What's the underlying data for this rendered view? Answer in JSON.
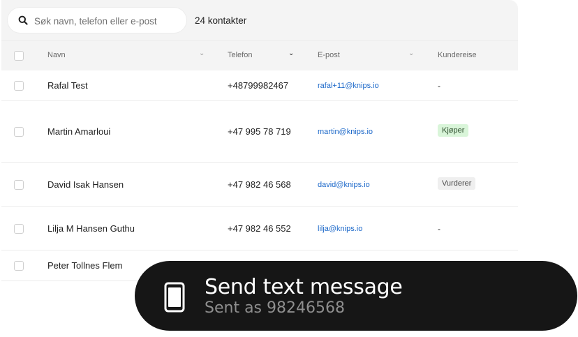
{
  "search": {
    "placeholder": "Søk navn, telefon eller e-post",
    "value": ""
  },
  "contact_count": "24 kontakter",
  "columns": {
    "name": "Navn",
    "phone": "Telefon",
    "email": "E-post",
    "journey": "Kundereise"
  },
  "rows": [
    {
      "name": "Rafal Test",
      "phone": "+48799982467",
      "email": "rafal+11@knips.io",
      "journey": "-"
    },
    {
      "name": "Martin Amarloui",
      "phone": "+47 995 78 719",
      "email": "martin@knips.io",
      "journey": "Kjøper"
    },
    {
      "name": "David Isak Hansen",
      "phone": "+47 982 46 568",
      "email": "david@knips.io",
      "journey": "Vurderer"
    },
    {
      "name": "Lilja M Hansen Guthu",
      "phone": "+47 982 46 552",
      "email": "lilja@knips.io",
      "journey": "-"
    },
    {
      "name": "Peter Tollnes Flem",
      "phone": "",
      "email": "",
      "journey": ""
    }
  ],
  "toast": {
    "title": "Send text message",
    "subtitle": "Sent as 98246568",
    "icon": "phone-icon"
  },
  "colors": {
    "email_link": "#1a67c9",
    "badge_buyer_bg": "#d9f5d9",
    "badge_consider_bg": "#efefef",
    "toast_bg": "#161616"
  }
}
